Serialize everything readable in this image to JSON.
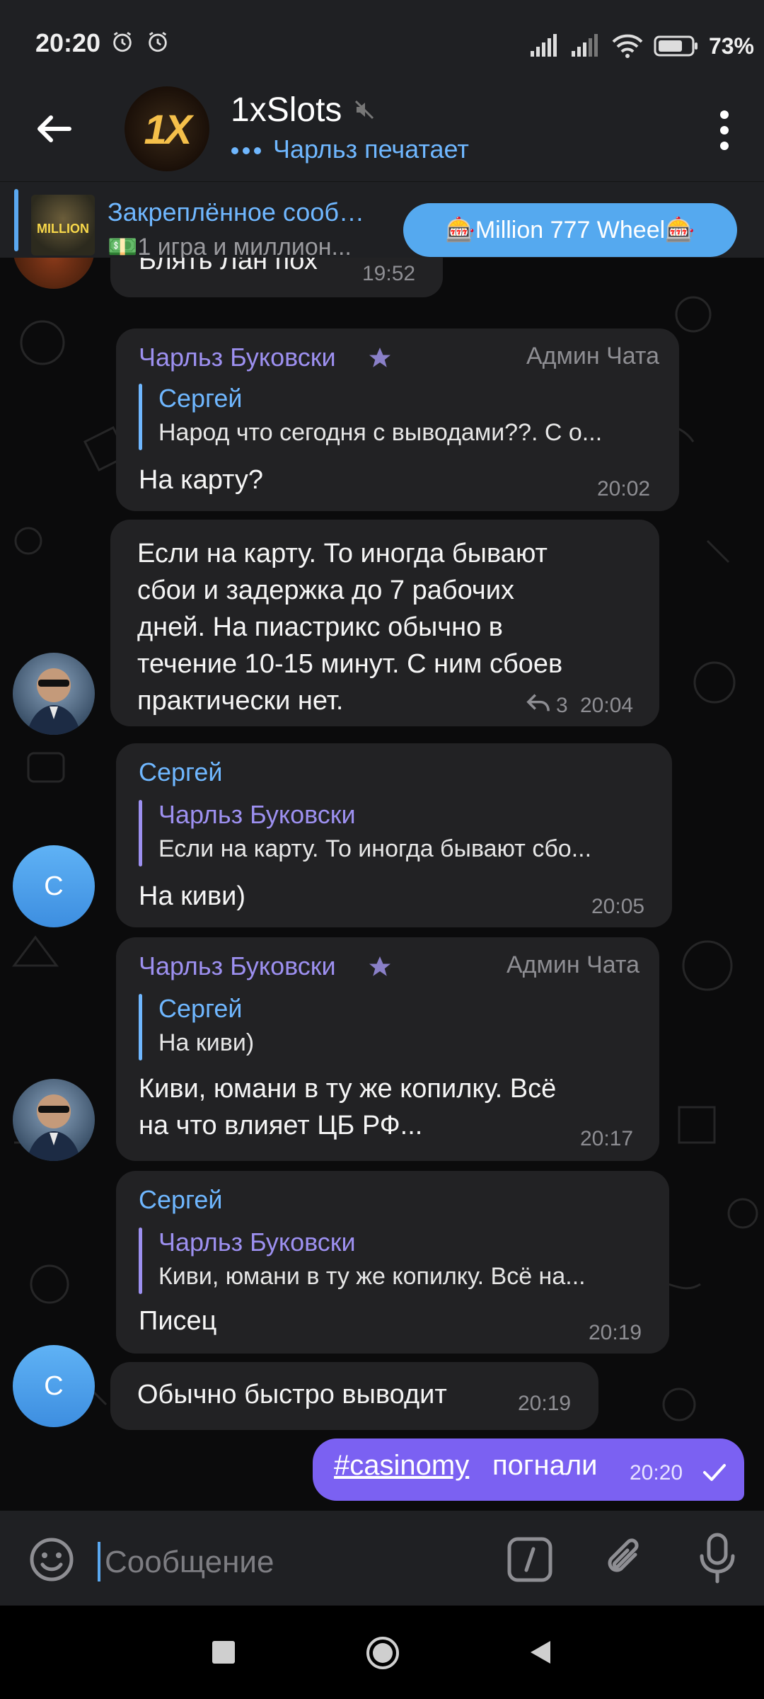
{
  "status_bar": {
    "time": "20:20",
    "battery": "73%"
  },
  "header": {
    "title": "1xSlots",
    "status": "Чарльз печатает",
    "avatar_text": "1X"
  },
  "pinned": {
    "title": "Закреплённое сообщение",
    "text": "💵1 игра и миллион...",
    "button": "🎰Million 777 Wheel🎰",
    "thumb_text": "MILLION"
  },
  "messages": [
    {
      "text": "Блять Лан пох",
      "time": "19:52"
    },
    {
      "sender": "Чарльз Буковски",
      "role": "Админ Чата",
      "reply": {
        "name": "Сергей",
        "text": "Народ что сегодня с выводами??. С о..."
      },
      "text": "На карту?",
      "time": "20:02"
    },
    {
      "lines": [
        "Если на карту. То иногда бывают",
        "сбои и задержка до 7 рабочих",
        "дней. На пиастрикс обычно в",
        "течение 10-15 минут. С ним сбоев",
        "практически нет."
      ],
      "replies": "3",
      "time": "20:04"
    },
    {
      "sender": "Сергей",
      "reply": {
        "name": "Чарльз Буковски",
        "text": "Если на карту. То иногда бывают сбо..."
      },
      "text": "На киви)",
      "time": "20:05",
      "avatar": "С"
    },
    {
      "sender": "Чарльз Буковски",
      "role": "Админ Чата",
      "reply": {
        "name": "Сергей",
        "text": "На киви)"
      },
      "lines": [
        "Киви, юмани в ту же копилку. Всё",
        "на что влияет ЦБ РФ..."
      ],
      "time": "20:17"
    },
    {
      "sender": "Сергей",
      "reply": {
        "name": "Чарльз Буковски",
        "text": "Киви, юмани в ту же копилку. Всё на..."
      },
      "text": "Писец",
      "time": "20:19"
    },
    {
      "text": "Обычно быстро выводит",
      "time": "20:19",
      "avatar": "С"
    }
  ],
  "own_message": {
    "hashtag": "#casinomy",
    "text": "погнали",
    "time": "20:20"
  },
  "input": {
    "placeholder": "Сообщение"
  },
  "colors": {
    "accent": "#5aa8f0",
    "own_bubble": "#7b61f2",
    "admin_name": "#9d90f0",
    "sergey_name": "#6fb7ff"
  }
}
